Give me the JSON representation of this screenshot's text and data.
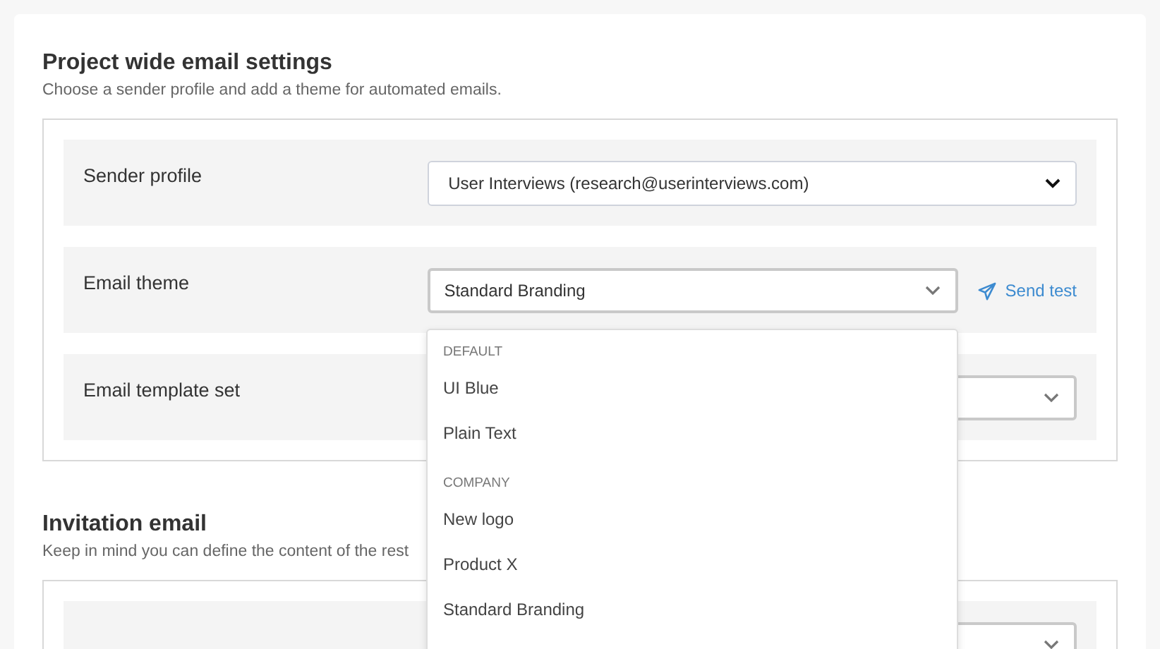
{
  "sections": [
    {
      "title": "Project wide email settings",
      "subtitle": "Choose a sender profile and add a theme for automated emails.",
      "rows": [
        {
          "label": "Sender profile",
          "kind": "native",
          "value": "User Interviews (research@userinterviews.com)"
        },
        {
          "label": "Email theme",
          "kind": "custom",
          "value": "Standard Branding",
          "link": "Send test"
        },
        {
          "label": "Email template set",
          "kind": "custom"
        }
      ]
    },
    {
      "title": "Invitation email",
      "subtitle": "Keep in mind you can define the content of the rest",
      "rows": [
        {
          "kind": "custom"
        }
      ]
    }
  ],
  "dropdown": {
    "groups": [
      {
        "header": "DEFAULT",
        "items": [
          "UI Blue",
          "Plain Text"
        ]
      },
      {
        "header": "COMPANY",
        "items": [
          "New logo",
          "Product X",
          "Standard Branding"
        ]
      }
    ]
  }
}
